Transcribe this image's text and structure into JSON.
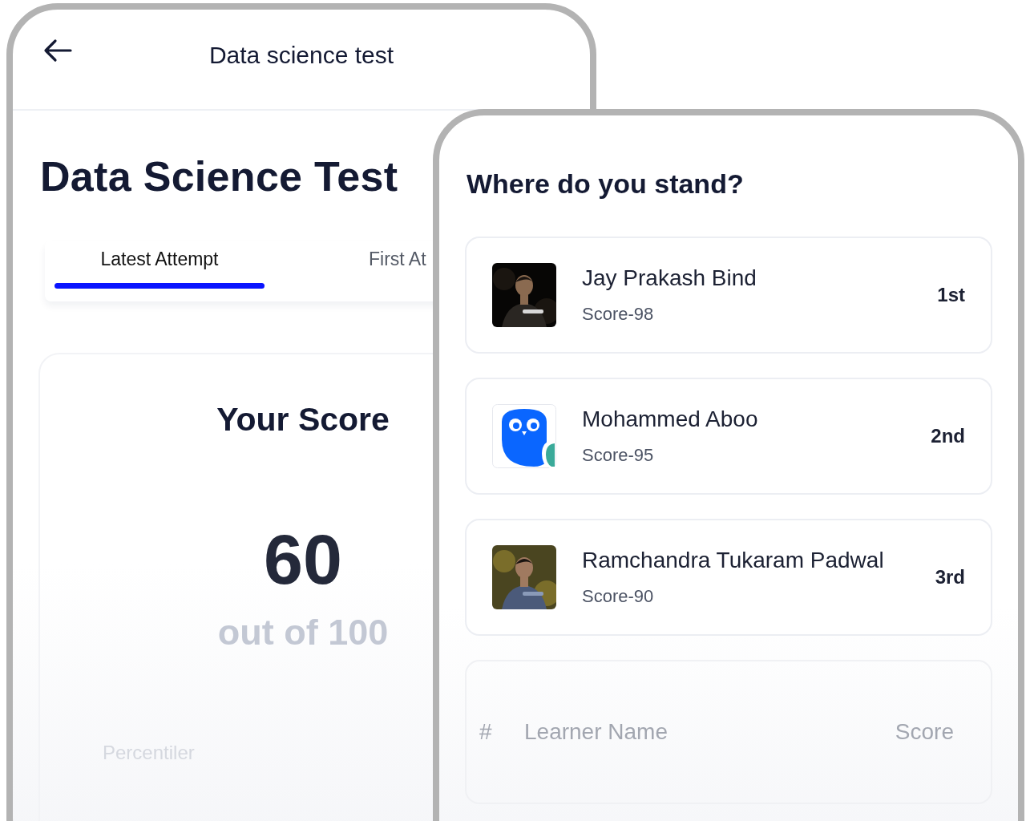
{
  "left_screen": {
    "header": {
      "title": "Data science test"
    },
    "heading": "Data Science Test",
    "tabs": [
      {
        "label": "Latest Attempt",
        "selected": true
      },
      {
        "label": "First At",
        "selected": false
      }
    ],
    "score_card": {
      "title": "Your Score",
      "score": "60",
      "total": "out of 100",
      "percentile_label": "Percentiler"
    }
  },
  "right_screen": {
    "title": "Where do you stand?",
    "leaders": [
      {
        "name": "Jay Prakash Bind",
        "score": "Score-98",
        "rank": "1st",
        "kind": "picture"
      },
      {
        "name": "Mohammed Aboo",
        "score": "Score-95",
        "rank": "2nd",
        "kind": "logo"
      },
      {
        "name": "Ramchandra Tukaram Padwal",
        "score": "Score-90",
        "rank": "3rd",
        "kind": "picture"
      }
    ],
    "table": {
      "columns": [
        "#",
        "Learner Name",
        "Score"
      ]
    }
  }
}
